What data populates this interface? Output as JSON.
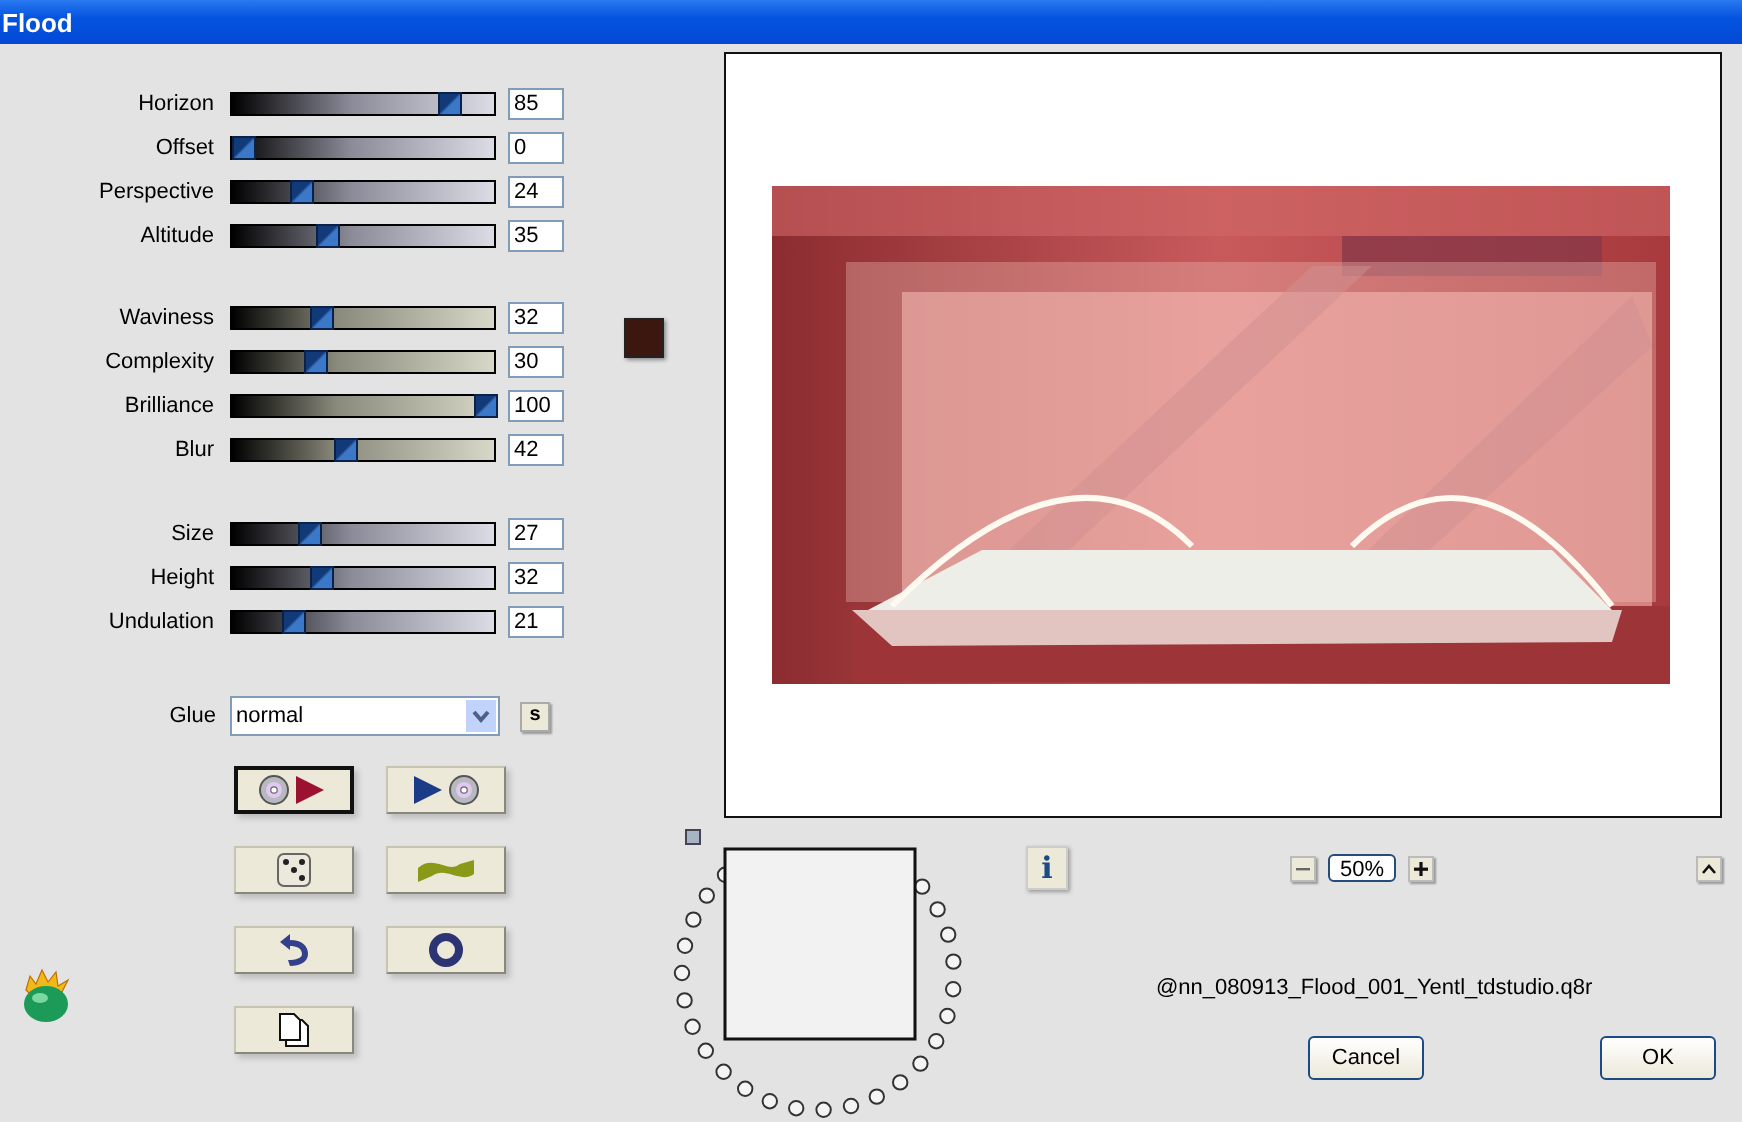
{
  "window": {
    "title": "Flood"
  },
  "slider_groups": [
    {
      "sliders": [
        {
          "label": "Horizon",
          "value": "85",
          "level": 0.85
        },
        {
          "label": "Offset",
          "value": "0",
          "level": 0
        },
        {
          "label": "Perspective",
          "value": "24",
          "level": 0.24
        },
        {
          "label": "Altitude",
          "value": "35",
          "level": 0.35
        }
      ]
    },
    {
      "sliders": [
        {
          "label": "Waviness",
          "value": "32",
          "level": 0.32
        },
        {
          "label": "Complexity",
          "value": "30",
          "level": 0.3
        },
        {
          "label": "Brilliance",
          "value": "100",
          "level": 1
        },
        {
          "label": "Blur",
          "value": "42",
          "level": 0.42
        }
      ],
      "swatch": {
        "color": "#3c1710"
      }
    },
    {
      "sliders": [
        {
          "label": "Size",
          "value": "27",
          "level": 0.27
        },
        {
          "label": "Height",
          "value": "32",
          "level": 0.32
        },
        {
          "label": "Undulation",
          "value": "21",
          "level": 0.21
        }
      ]
    }
  ],
  "glue": {
    "label": "Glue",
    "value": "normal",
    "side_button": "s"
  },
  "tool_buttons": [
    {
      "kind": "open",
      "focused": true
    },
    {
      "kind": "save",
      "focused": false
    },
    {
      "kind": "random",
      "focused": false
    },
    {
      "kind": "wave",
      "focused": false
    },
    {
      "kind": "undo",
      "focused": false
    },
    {
      "kind": "ring",
      "focused": false
    },
    {
      "kind": "copy",
      "focused": false
    }
  ],
  "info_button": "i",
  "zoom": {
    "value": "50%"
  },
  "filename": "@nn_080913_Flood_001_Yentl_tdstudio.q8r",
  "buttons": [
    "Cancel",
    "OK"
  ]
}
